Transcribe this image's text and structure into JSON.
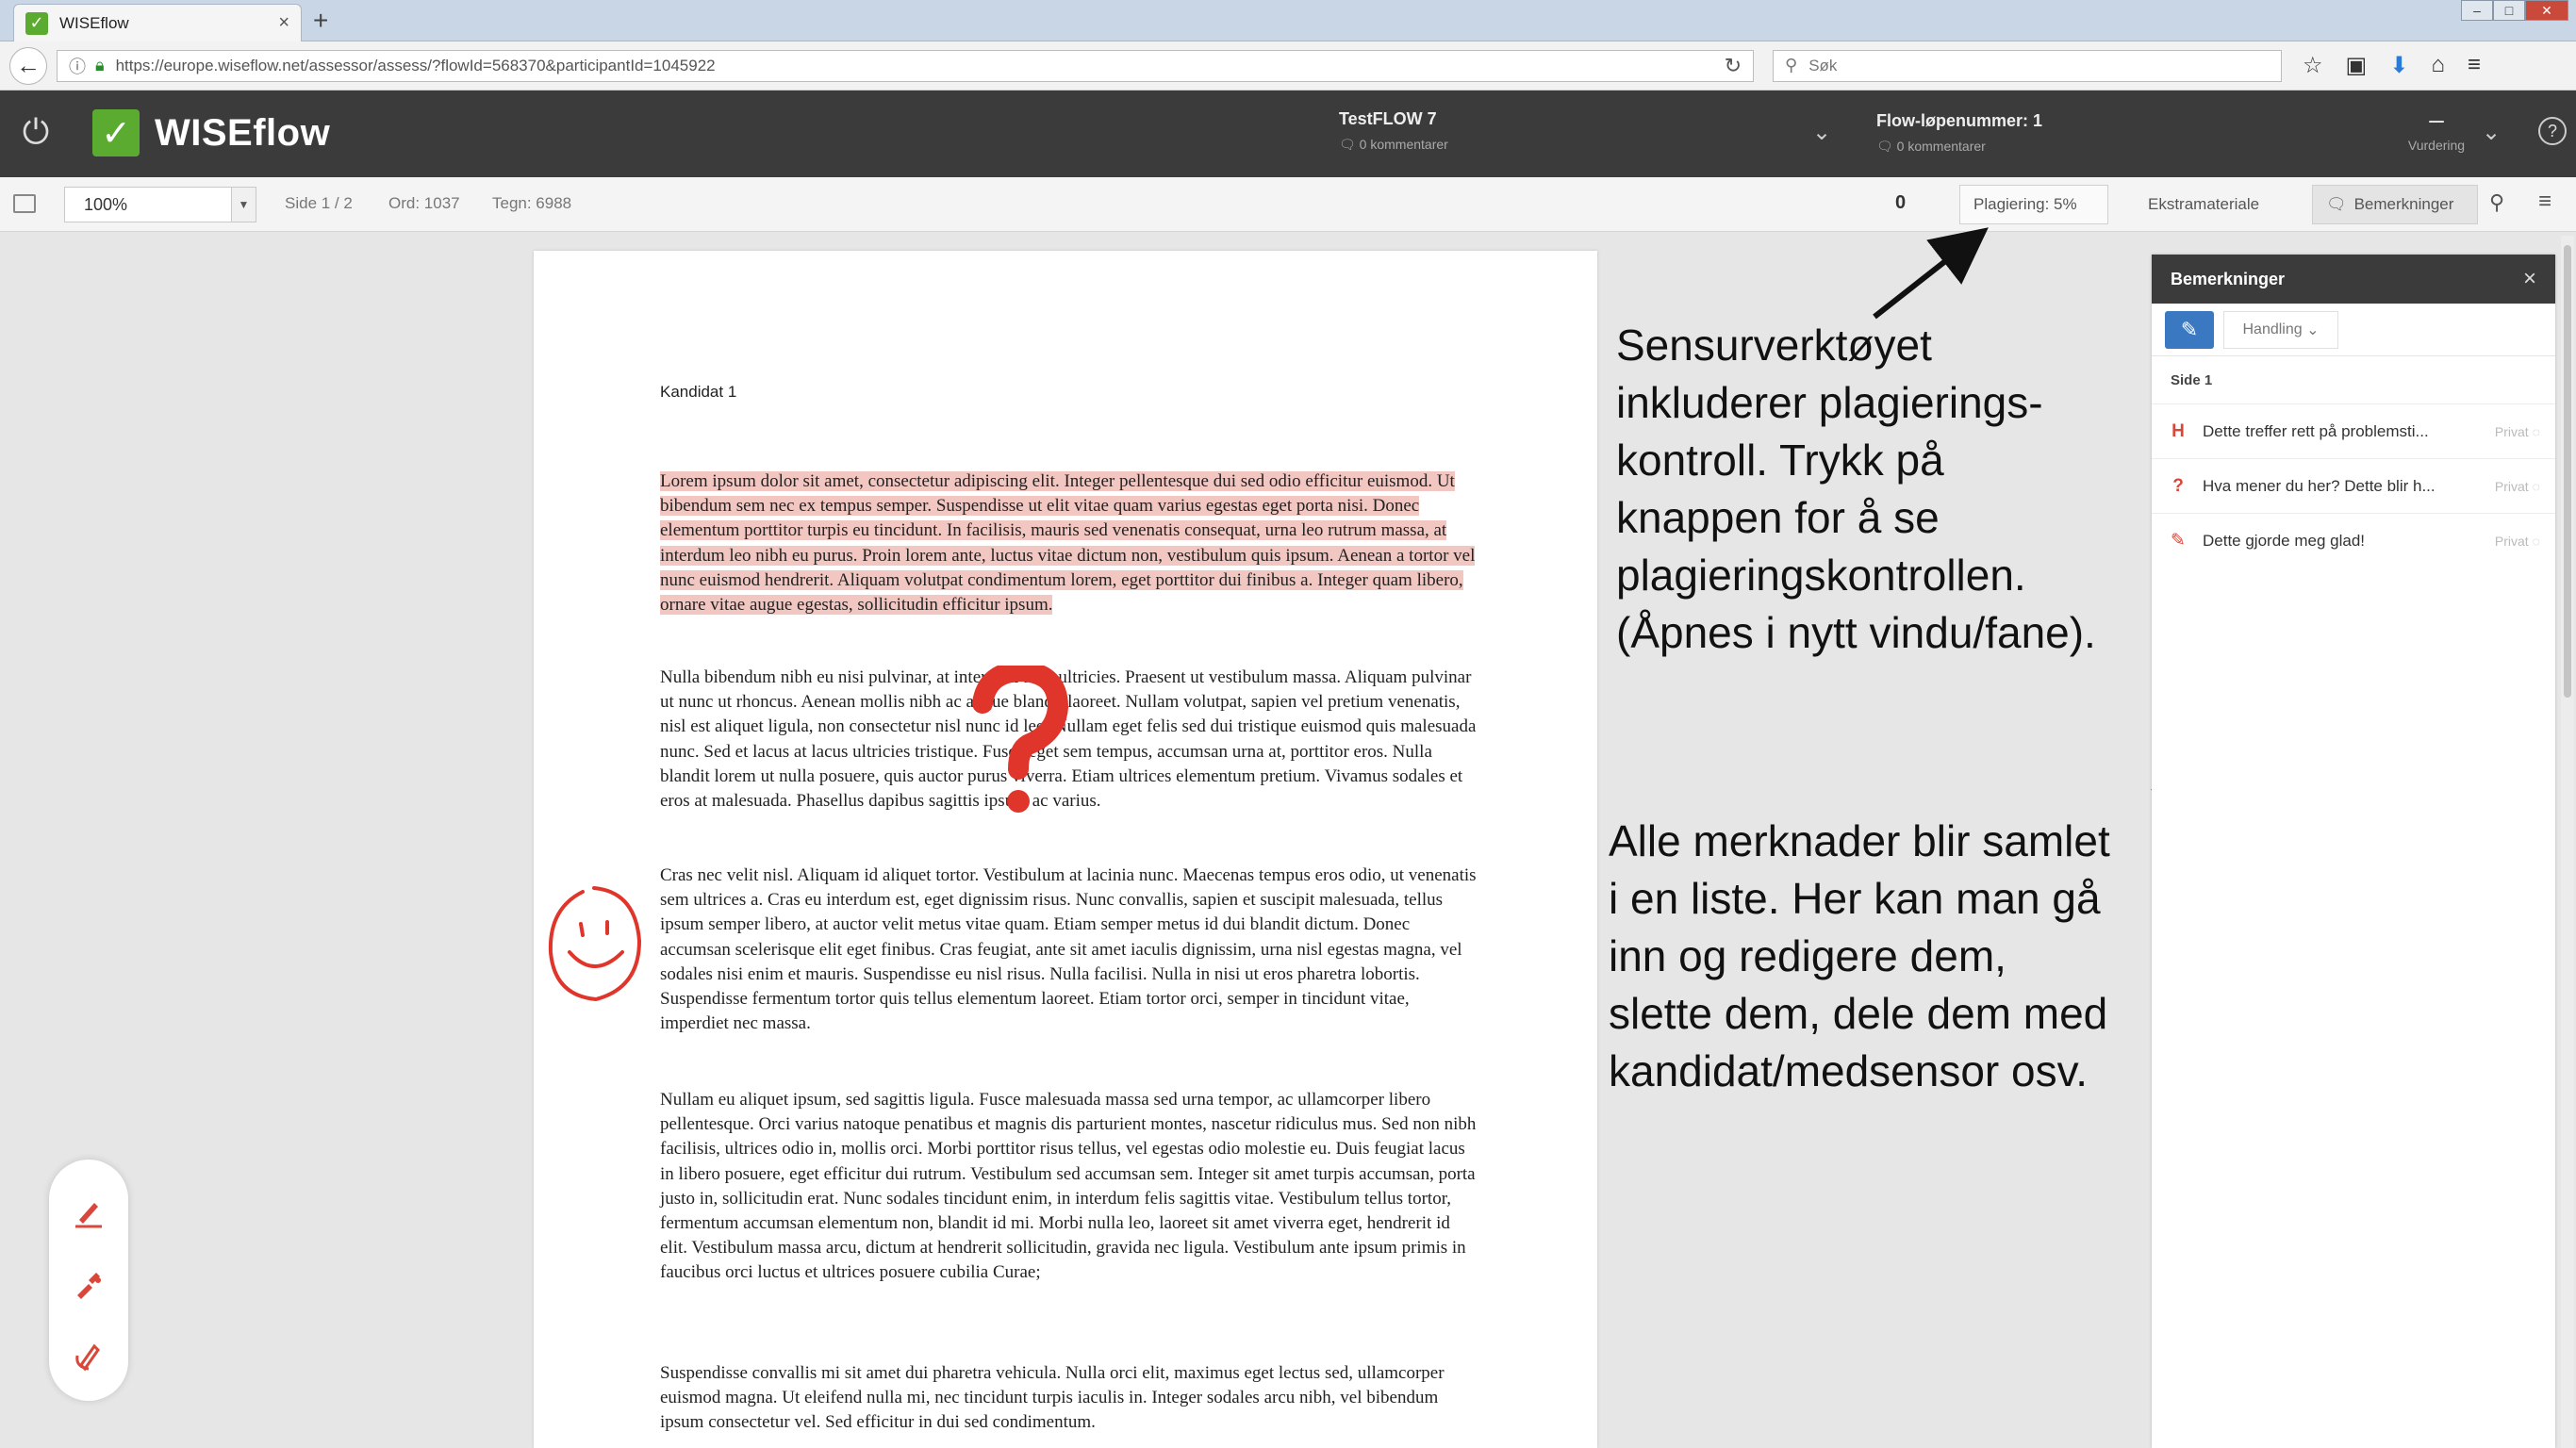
{
  "browser": {
    "tab_title": "WISEflow",
    "tab_close": "×",
    "new_tab": "+",
    "url": "https://europe.wiseflow.net/assessor/assess/?flowId=568370&participantId=1045922",
    "search_placeholder": "Søk"
  },
  "app": {
    "logo_text": "WISEflow",
    "flow_name": "TestFLOW 7",
    "flow_comments": "0 kommentarer",
    "run_number": "Flow-løpenummer: 1",
    "run_comments": "0 kommentarer",
    "assessment_value": "–",
    "assessment_label": "Vurdering",
    "help": "?"
  },
  "toolbar": {
    "zoom": "100%",
    "page": "Side 1 / 2",
    "words": "Ord: 1037",
    "chars": "Tegn: 6988",
    "count": "0",
    "plagiarism": "Plagiering: 5%",
    "extra_material": "Ekstramateriale",
    "remarks": "Bemerkninger"
  },
  "document": {
    "candidate": "Kandidat 1",
    "paragraphs": [
      "Lorem ipsum dolor sit amet, consectetur adipiscing elit. Integer pellentesque dui sed odio efficitur euismod. Ut bibendum sem nec ex tempus semper. Suspendisse ut elit vitae quam varius egestas eget porta nisi. Donec elementum porttitor turpis eu tincidunt. In facilisis, mauris sed venenatis consequat, urna leo rutrum massa, at interdum leo nibh eu purus. Proin lorem ante, luctus vitae dictum non, vestibulum quis ipsum. Aenean a tortor vel nunc euismod hendrerit. Aliquam volutpat condimentum lorem, eget porttitor dui finibus a. Integer quam libero, ornare vitae augue egestas, sollicitudin efficitur ipsum.",
      "Nulla bibendum nibh eu nisi pulvinar, at interdum arcu ultricies. Praesent ut vestibulum massa. Aliquam pulvinar ut nunc ut rhoncus. Aenean mollis nibh ac augue blandit laoreet. Nullam volutpat, sapien vel pretium venenatis, nisl est aliquet ligula, non consectetur nisl nunc id leo. Nullam eget felis sed dui tristique euismod quis malesuada nunc. Sed et lacus at lacus ultricies tristique. Fusce eget sem tempus, accumsan urna at, porttitor eros. Nulla blandit lorem ut nulla posuere, quis auctor purus viverra. Etiam ultrices elementum pretium. Vivamus sodales et eros at malesuada. Phasellus dapibus sagittis ipsum ac varius.",
      "Cras nec velit nisl. Aliquam id aliquet tortor. Vestibulum at lacinia nunc. Maecenas tempus eros odio, ut venenatis sem ultrices a. Cras eu interdum est, eget dignissim risus. Nunc convallis, sapien et suscipit malesuada, tellus ipsum semper libero, at auctor velit metus vitae quam. Etiam semper metus id dui blandit dictum. Donec accumsan scelerisque elit eget finibus. Cras feugiat, ante sit amet iaculis dignissim, urna nisl egestas magna, vel sodales nisi enim et mauris. Suspendisse eu nisl risus. Nulla facilisi. Nulla in nisi ut eros pharetra lobortis. Suspendisse fermentum tortor quis tellus elementum laoreet. Etiam tortor orci, semper in tincidunt vitae, imperdiet nec massa.",
      "Nullam eu aliquet ipsum, sed sagittis ligula. Fusce malesuada massa sed urna tempor, ac ullamcorper libero pellentesque. Orci varius natoque penatibus et magnis dis parturient montes, nascetur ridiculus mus. Sed non nibh facilisis, ultrices odio in, mollis orci. Morbi porttitor risus tellus, vel egestas odio molestie eu. Duis feugiat lacus in libero posuere, eget efficitur dui rutrum. Vestibulum sed accumsan sem. Integer sit amet turpis accumsan, porta justo in, sollicitudin erat. Nunc sodales tincidunt enim, in interdum felis sagittis vitae. Vestibulum tellus tortor, fermentum accumsan elementum non, blandit id mi. Morbi nulla leo, laoreet sit amet viverra eget, hendrerit id elit. Vestibulum massa arcu, dictum at hendrerit sollicitudin, gravida nec ligula. Vestibulum ante ipsum primis in faucibus orci luctus et ultrices posuere cubilia Curae;",
      "Suspendisse convallis mi sit amet dui pharetra vehicula. Nulla orci elit, maximus eget lectus sed, ullamcorper euismod magna. Ut eleifend nulla mi, nec tincidunt turpis iaculis in. Integer sodales arcu nibh, vel bibendum ipsum consectetur vel. Sed efficitur in dui sed condimentum."
    ]
  },
  "annotations": {
    "note1": "Sensurverktøyet\ninkluderer plagierings-\nkontroll. Trykk på\nknappen for å se\nplagieringskontrollen.\n(Åpnes i nytt vindu/fane).",
    "note2": "Alle merknader blir samlet\ni en liste. Her kan man gå\ninn og redigere dem,\nslette dem, dele dem med\nkandidat/medsensor osv."
  },
  "panel": {
    "title": "Bemerkninger",
    "close": "×",
    "action_label": "Handling",
    "section": "Side 1",
    "comments": [
      {
        "icon": "H",
        "text": "Dette treffer rett på problemsti...",
        "visibility": "Privat"
      },
      {
        "icon": "?",
        "text": "Hva mener du her? Dette blir h...",
        "visibility": "Privat"
      },
      {
        "icon": "✎",
        "text": "Dette gjorde meg glad!",
        "visibility": "Privat"
      }
    ]
  },
  "colors": {
    "accent_green": "#5aab2f",
    "header_dark": "#3b3b3b",
    "highlight": "#f2c7c2",
    "annotation_red": "#e0352b",
    "button_blue": "#3a78c2"
  }
}
